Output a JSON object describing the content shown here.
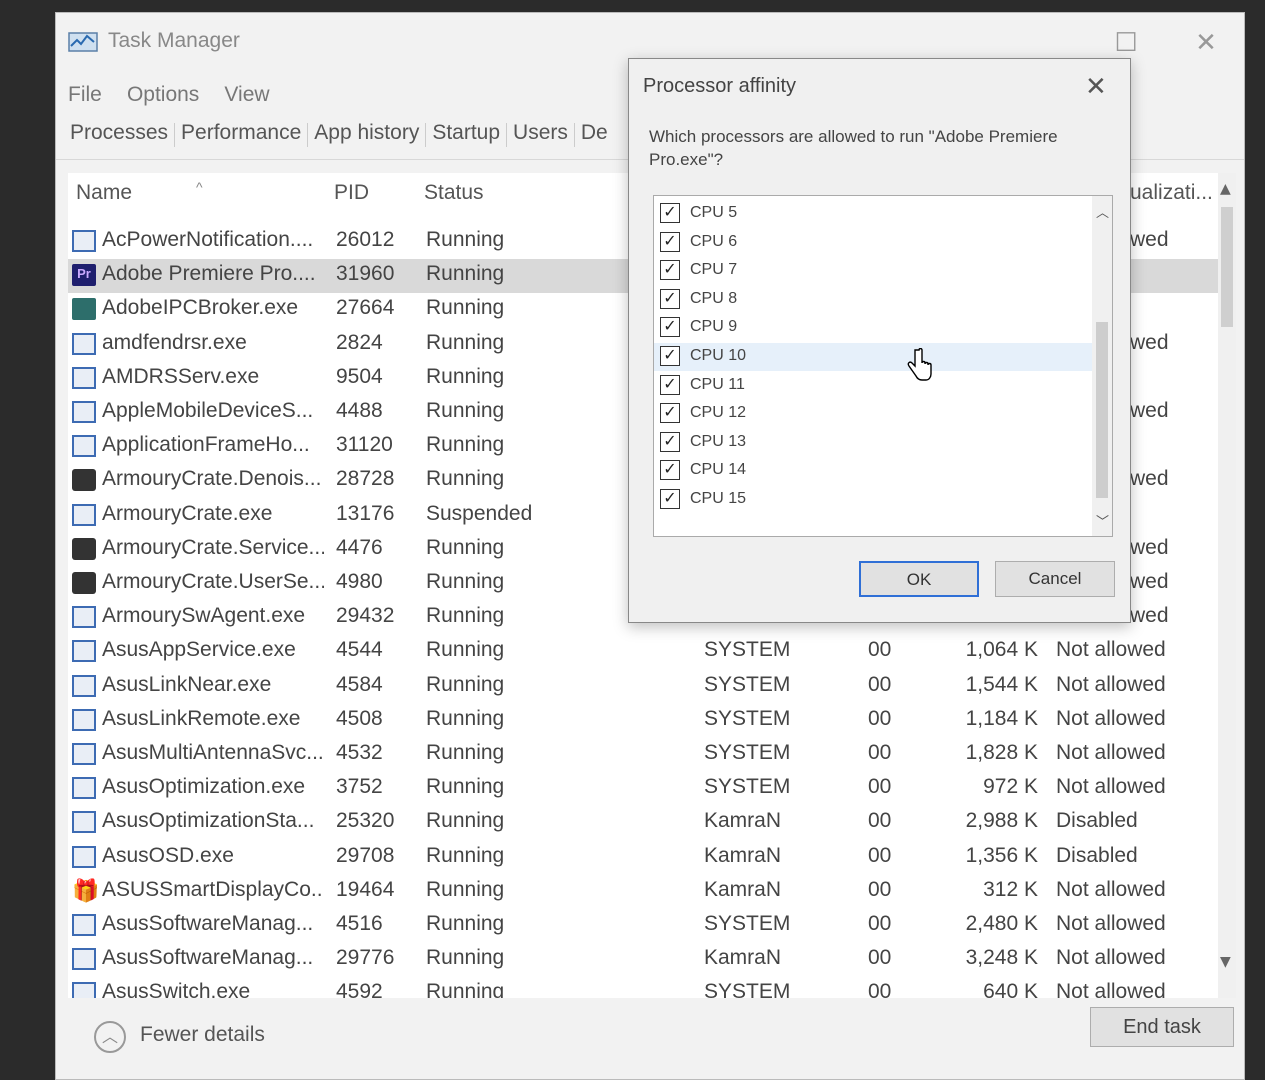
{
  "window": {
    "title": "Task Manager",
    "menu": [
      "File",
      "Options",
      "View"
    ],
    "tabs": [
      "Processes",
      "Performance",
      "App history",
      "Startup",
      "Users",
      "De"
    ],
    "maximize_glyph": "☐",
    "close_glyph": "✕"
  },
  "columns": {
    "name": "Name",
    "pid": "PID",
    "status": "Status",
    "uac": "ualizati..."
  },
  "processes": [
    {
      "name": "AcPowerNotification....",
      "pid": "26012",
      "status": "Running",
      "user": "",
      "cpu": "",
      "mem": "",
      "uac": "wed",
      "icon": "svc"
    },
    {
      "name": "Adobe Premiere Pro....",
      "pid": "31960",
      "status": "Running",
      "user": "",
      "cpu": "",
      "mem": "",
      "uac": "",
      "icon": "pr",
      "selected": true
    },
    {
      "name": "AdobeIPCBroker.exe",
      "pid": "27664",
      "status": "Running",
      "user": "",
      "cpu": "",
      "mem": "",
      "uac": "",
      "icon": "ipc"
    },
    {
      "name": "amdfendrsr.exe",
      "pid": "2824",
      "status": "Running",
      "user": "",
      "cpu": "",
      "mem": "",
      "uac": "wed",
      "icon": "svc"
    },
    {
      "name": "AMDRSServ.exe",
      "pid": "9504",
      "status": "Running",
      "user": "",
      "cpu": "",
      "mem": "",
      "uac": "",
      "icon": "svc"
    },
    {
      "name": "AppleMobileDeviceS...",
      "pid": "4488",
      "status": "Running",
      "user": "",
      "cpu": "",
      "mem": "",
      "uac": "wed",
      "icon": "svc"
    },
    {
      "name": "ApplicationFrameHo...",
      "pid": "31120",
      "status": "Running",
      "user": "",
      "cpu": "",
      "mem": "",
      "uac": "",
      "icon": "svc"
    },
    {
      "name": "ArmouryCrate.Denois...",
      "pid": "28728",
      "status": "Running",
      "user": "",
      "cpu": "",
      "mem": "",
      "uac": "wed",
      "icon": "armoury"
    },
    {
      "name": "ArmouryCrate.exe",
      "pid": "13176",
      "status": "Suspended",
      "user": "",
      "cpu": "",
      "mem": "",
      "uac": "",
      "icon": "svc"
    },
    {
      "name": "ArmouryCrate.Service...",
      "pid": "4476",
      "status": "Running",
      "user": "",
      "cpu": "",
      "mem": "",
      "uac": "wed",
      "icon": "armoury"
    },
    {
      "name": "ArmouryCrate.UserSe...",
      "pid": "4980",
      "status": "Running",
      "user": "",
      "cpu": "",
      "mem": "",
      "uac": "wed",
      "icon": "armoury"
    },
    {
      "name": "ArmourySwAgent.exe",
      "pid": "29432",
      "status": "Running",
      "user": "",
      "cpu": "",
      "mem": "",
      "uac": "wed",
      "icon": "svc"
    },
    {
      "name": "AsusAppService.exe",
      "pid": "4544",
      "status": "Running",
      "user": "SYSTEM",
      "cpu": "00",
      "mem": "1,064 K",
      "uac": "Not allowed",
      "icon": "svc"
    },
    {
      "name": "AsusLinkNear.exe",
      "pid": "4584",
      "status": "Running",
      "user": "SYSTEM",
      "cpu": "00",
      "mem": "1,544 K",
      "uac": "Not allowed",
      "icon": "svc"
    },
    {
      "name": "AsusLinkRemote.exe",
      "pid": "4508",
      "status": "Running",
      "user": "SYSTEM",
      "cpu": "00",
      "mem": "1,184 K",
      "uac": "Not allowed",
      "icon": "svc"
    },
    {
      "name": "AsusMultiAntennaSvc...",
      "pid": "4532",
      "status": "Running",
      "user": "SYSTEM",
      "cpu": "00",
      "mem": "1,828 K",
      "uac": "Not allowed",
      "icon": "svc"
    },
    {
      "name": "AsusOptimization.exe",
      "pid": "3752",
      "status": "Running",
      "user": "SYSTEM",
      "cpu": "00",
      "mem": "972 K",
      "uac": "Not allowed",
      "icon": "svc"
    },
    {
      "name": "AsusOptimizationSta...",
      "pid": "25320",
      "status": "Running",
      "user": "KamraN",
      "cpu": "00",
      "mem": "2,988 K",
      "uac": "Disabled",
      "icon": "svc"
    },
    {
      "name": "AsusOSD.exe",
      "pid": "29708",
      "status": "Running",
      "user": "KamraN",
      "cpu": "00",
      "mem": "1,356 K",
      "uac": "Disabled",
      "icon": "svc"
    },
    {
      "name": "ASUSSmartDisplayCo...",
      "pid": "19464",
      "status": "Running",
      "user": "KamraN",
      "cpu": "00",
      "mem": "312 K",
      "uac": "Not allowed",
      "icon": "gift"
    },
    {
      "name": "AsusSoftwareManag...",
      "pid": "4516",
      "status": "Running",
      "user": "SYSTEM",
      "cpu": "00",
      "mem": "2,480 K",
      "uac": "Not allowed",
      "icon": "svc"
    },
    {
      "name": "AsusSoftwareManag...",
      "pid": "29776",
      "status": "Running",
      "user": "KamraN",
      "cpu": "00",
      "mem": "3,248 K",
      "uac": "Not allowed",
      "icon": "svc"
    },
    {
      "name": "AsusSwitch.exe",
      "pid": "4592",
      "status": "Running",
      "user": "SYSTEM",
      "cpu": "00",
      "mem": "640 K",
      "uac": "Not allowed",
      "icon": "svc"
    }
  ],
  "footer": {
    "fewer_details": "Fewer details",
    "end_task": "End task"
  },
  "dialog": {
    "title": "Processor affinity",
    "question": "Which processors are allowed to run \"Adobe Premiere Pro.exe\"?",
    "cpus": [
      {
        "label": "CPU 5",
        "checked": true
      },
      {
        "label": "CPU 6",
        "checked": true
      },
      {
        "label": "CPU 7",
        "checked": true
      },
      {
        "label": "CPU 8",
        "checked": true
      },
      {
        "label": "CPU 9",
        "checked": true
      },
      {
        "label": "CPU 10",
        "checked": true,
        "hover": true
      },
      {
        "label": "CPU 11",
        "checked": true
      },
      {
        "label": "CPU 12",
        "checked": true
      },
      {
        "label": "CPU 13",
        "checked": true
      },
      {
        "label": "CPU 14",
        "checked": true
      },
      {
        "label": "CPU 15",
        "checked": true
      }
    ],
    "ok": "OK",
    "cancel": "Cancel"
  }
}
